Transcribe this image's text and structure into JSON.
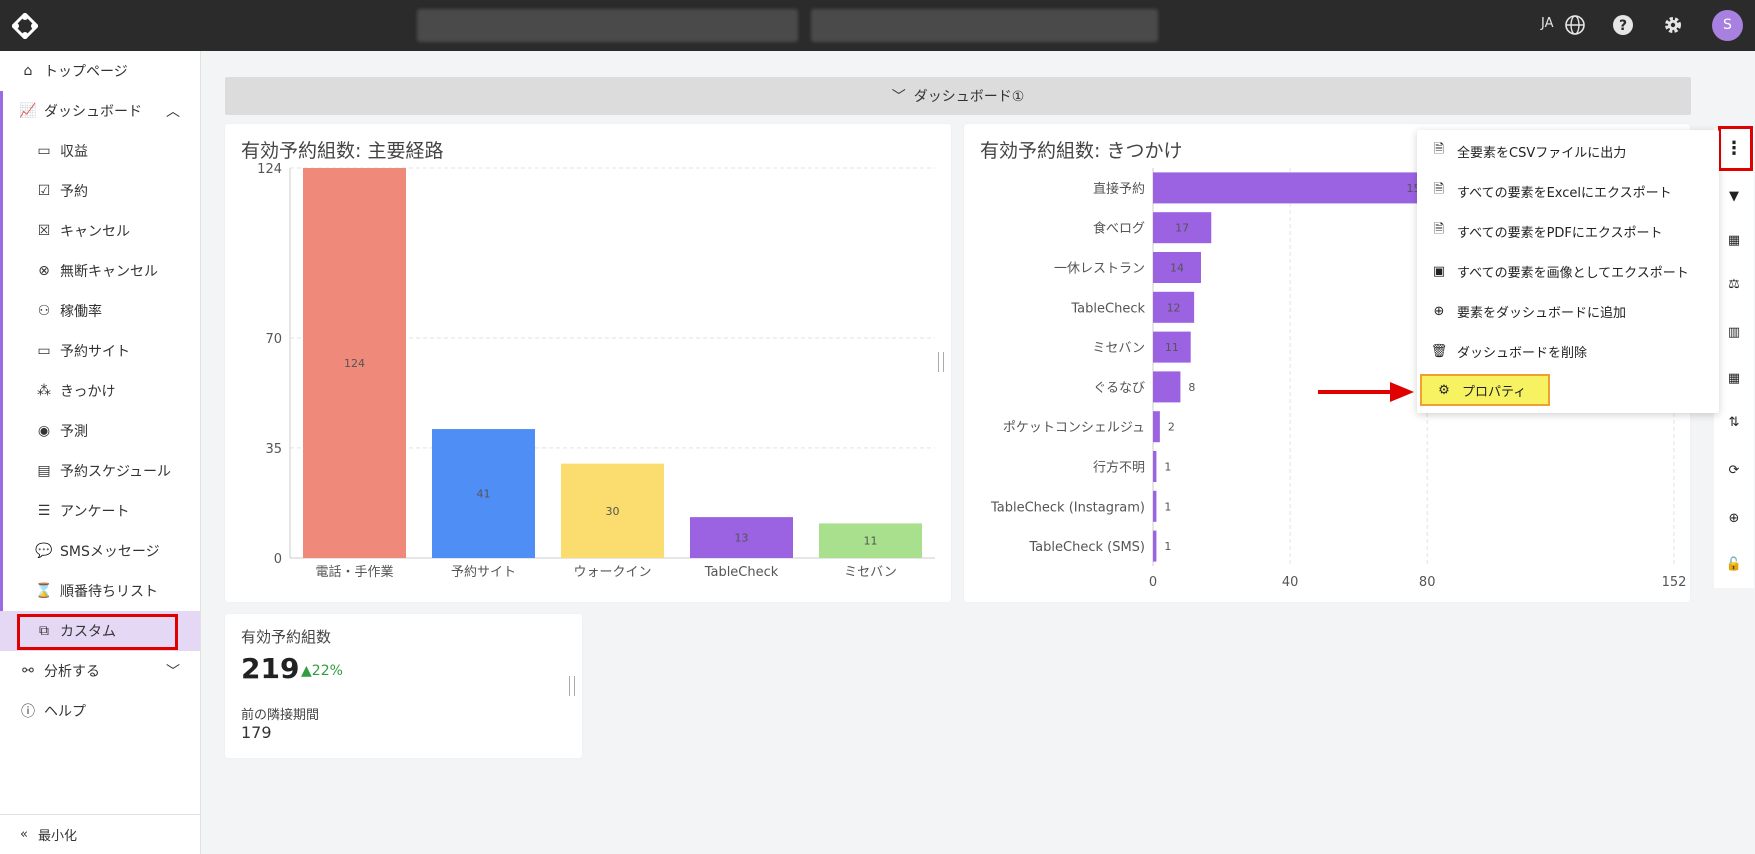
{
  "topbar": {
    "language": "JA",
    "avatar_letter": "S"
  },
  "sidebar": {
    "items": [
      {
        "label": "トップページ",
        "icon": "home-icon"
      },
      {
        "label": "ダッシュボード",
        "icon": "chart-icon"
      },
      {
        "label": "収益",
        "icon": "money-icon"
      },
      {
        "label": "予約",
        "icon": "calendar-check-icon"
      },
      {
        "label": "キャンセル",
        "icon": "calendar-x-icon"
      },
      {
        "label": "無断キャンセル",
        "icon": "circle-x-icon"
      },
      {
        "label": "稼働率",
        "icon": "people-icon"
      },
      {
        "label": "予約サイト",
        "icon": "monitor-icon"
      },
      {
        "label": "きっかけ",
        "icon": "share-icon"
      },
      {
        "label": "予測",
        "icon": "eye-icon"
      },
      {
        "label": "予約スケジュール",
        "icon": "schedule-icon"
      },
      {
        "label": "アンケート",
        "icon": "survey-icon"
      },
      {
        "label": "SMSメッセージ",
        "icon": "message-icon"
      },
      {
        "label": "順番待ちリスト",
        "icon": "hourglass-icon"
      },
      {
        "label": "カスタム",
        "icon": "custom-icon"
      },
      {
        "label": "分析する",
        "icon": "binoculars-icon"
      },
      {
        "label": "ヘルプ",
        "icon": "help-icon"
      }
    ],
    "minimize_label": "最小化"
  },
  "dashboard": {
    "title": "ダッシュボード①"
  },
  "widgets": {
    "main_route": {
      "title": "有効予約組数: 主要経路"
    },
    "trigger": {
      "title": "有効予約組数: きつかけ"
    },
    "kpi": {
      "title": "有効予約組数",
      "value": "219",
      "change": "22%",
      "prev_label": "前の隣接期間",
      "prev_value": "179"
    }
  },
  "menu": {
    "items": [
      {
        "label": "全要素をCSVファイルに出力",
        "icon": "csv-file-icon"
      },
      {
        "label": "すべての要素をExcelにエクスポート",
        "icon": "excel-file-icon"
      },
      {
        "label": "すべての要素をPDFにエクスポート",
        "icon": "pdf-file-icon"
      },
      {
        "label": "すべての要素を画像としてエクスポート",
        "icon": "image-icon"
      },
      {
        "label": "要素をダッシュボードに追加",
        "icon": "plus-circle-icon"
      },
      {
        "label": "ダッシュボードを削除",
        "icon": "trash-icon"
      },
      {
        "label": "プロパティ",
        "icon": "gear-icon"
      }
    ]
  },
  "chart_data": [
    {
      "type": "bar",
      "title": "有効予約組数: 主要経路",
      "categories": [
        "電話・手作業",
        "予約サイト",
        "ウォークイン",
        "TableCheck",
        "ミセバン"
      ],
      "values": [
        124,
        41,
        30,
        13,
        11
      ],
      "colors": [
        "#ef8a7b",
        "#4f8ef5",
        "#fadd6e",
        "#9b62e2",
        "#a8e08e"
      ],
      "yticks": [
        0,
        35,
        70,
        124
      ],
      "ylim": [
        0,
        124
      ]
    },
    {
      "type": "bar",
      "orientation": "horizontal",
      "title": "有効予約組数: きつかけ",
      "categories": [
        "直接予約",
        "食べログ",
        "一休レストラン",
        "TableCheck",
        "ミセバン",
        "ぐるなび",
        "ポケットコンシェルジュ",
        "行方不明",
        "TableCheck (Instagram)",
        "TableCheck (SMS)"
      ],
      "values": [
        152,
        17,
        14,
        12,
        11,
        8,
        2,
        1,
        1,
        1
      ],
      "value_labels": [
        "15",
        "17",
        "14",
        "12",
        "11",
        "8",
        "2",
        "1",
        "1",
        "1"
      ],
      "color": "#9b62e2",
      "xticks": [
        0,
        40,
        80,
        152
      ],
      "xlim": [
        0,
        152
      ]
    }
  ]
}
